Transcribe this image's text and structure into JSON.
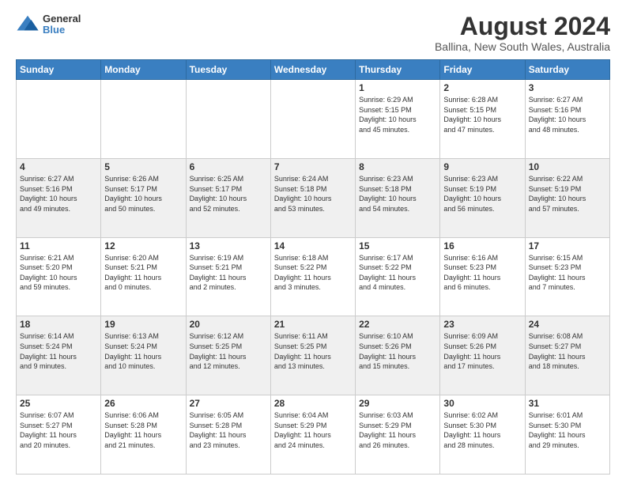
{
  "logo": {
    "general": "General",
    "blue": "Blue"
  },
  "title": "August 2024",
  "subtitle": "Ballina, New South Wales, Australia",
  "days_of_week": [
    "Sunday",
    "Monday",
    "Tuesday",
    "Wednesday",
    "Thursday",
    "Friday",
    "Saturday"
  ],
  "weeks": [
    [
      {
        "day": "",
        "info": ""
      },
      {
        "day": "",
        "info": ""
      },
      {
        "day": "",
        "info": ""
      },
      {
        "day": "",
        "info": ""
      },
      {
        "day": "1",
        "info": "Sunrise: 6:29 AM\nSunset: 5:15 PM\nDaylight: 10 hours\nand 45 minutes."
      },
      {
        "day": "2",
        "info": "Sunrise: 6:28 AM\nSunset: 5:15 PM\nDaylight: 10 hours\nand 47 minutes."
      },
      {
        "day": "3",
        "info": "Sunrise: 6:27 AM\nSunset: 5:16 PM\nDaylight: 10 hours\nand 48 minutes."
      }
    ],
    [
      {
        "day": "4",
        "info": "Sunrise: 6:27 AM\nSunset: 5:16 PM\nDaylight: 10 hours\nand 49 minutes."
      },
      {
        "day": "5",
        "info": "Sunrise: 6:26 AM\nSunset: 5:17 PM\nDaylight: 10 hours\nand 50 minutes."
      },
      {
        "day": "6",
        "info": "Sunrise: 6:25 AM\nSunset: 5:17 PM\nDaylight: 10 hours\nand 52 minutes."
      },
      {
        "day": "7",
        "info": "Sunrise: 6:24 AM\nSunset: 5:18 PM\nDaylight: 10 hours\nand 53 minutes."
      },
      {
        "day": "8",
        "info": "Sunrise: 6:23 AM\nSunset: 5:18 PM\nDaylight: 10 hours\nand 54 minutes."
      },
      {
        "day": "9",
        "info": "Sunrise: 6:23 AM\nSunset: 5:19 PM\nDaylight: 10 hours\nand 56 minutes."
      },
      {
        "day": "10",
        "info": "Sunrise: 6:22 AM\nSunset: 5:19 PM\nDaylight: 10 hours\nand 57 minutes."
      }
    ],
    [
      {
        "day": "11",
        "info": "Sunrise: 6:21 AM\nSunset: 5:20 PM\nDaylight: 10 hours\nand 59 minutes."
      },
      {
        "day": "12",
        "info": "Sunrise: 6:20 AM\nSunset: 5:21 PM\nDaylight: 11 hours\nand 0 minutes."
      },
      {
        "day": "13",
        "info": "Sunrise: 6:19 AM\nSunset: 5:21 PM\nDaylight: 11 hours\nand 2 minutes."
      },
      {
        "day": "14",
        "info": "Sunrise: 6:18 AM\nSunset: 5:22 PM\nDaylight: 11 hours\nand 3 minutes."
      },
      {
        "day": "15",
        "info": "Sunrise: 6:17 AM\nSunset: 5:22 PM\nDaylight: 11 hours\nand 4 minutes."
      },
      {
        "day": "16",
        "info": "Sunrise: 6:16 AM\nSunset: 5:23 PM\nDaylight: 11 hours\nand 6 minutes."
      },
      {
        "day": "17",
        "info": "Sunrise: 6:15 AM\nSunset: 5:23 PM\nDaylight: 11 hours\nand 7 minutes."
      }
    ],
    [
      {
        "day": "18",
        "info": "Sunrise: 6:14 AM\nSunset: 5:24 PM\nDaylight: 11 hours\nand 9 minutes."
      },
      {
        "day": "19",
        "info": "Sunrise: 6:13 AM\nSunset: 5:24 PM\nDaylight: 11 hours\nand 10 minutes."
      },
      {
        "day": "20",
        "info": "Sunrise: 6:12 AM\nSunset: 5:25 PM\nDaylight: 11 hours\nand 12 minutes."
      },
      {
        "day": "21",
        "info": "Sunrise: 6:11 AM\nSunset: 5:25 PM\nDaylight: 11 hours\nand 13 minutes."
      },
      {
        "day": "22",
        "info": "Sunrise: 6:10 AM\nSunset: 5:26 PM\nDaylight: 11 hours\nand 15 minutes."
      },
      {
        "day": "23",
        "info": "Sunrise: 6:09 AM\nSunset: 5:26 PM\nDaylight: 11 hours\nand 17 minutes."
      },
      {
        "day": "24",
        "info": "Sunrise: 6:08 AM\nSunset: 5:27 PM\nDaylight: 11 hours\nand 18 minutes."
      }
    ],
    [
      {
        "day": "25",
        "info": "Sunrise: 6:07 AM\nSunset: 5:27 PM\nDaylight: 11 hours\nand 20 minutes."
      },
      {
        "day": "26",
        "info": "Sunrise: 6:06 AM\nSunset: 5:28 PM\nDaylight: 11 hours\nand 21 minutes."
      },
      {
        "day": "27",
        "info": "Sunrise: 6:05 AM\nSunset: 5:28 PM\nDaylight: 11 hours\nand 23 minutes."
      },
      {
        "day": "28",
        "info": "Sunrise: 6:04 AM\nSunset: 5:29 PM\nDaylight: 11 hours\nand 24 minutes."
      },
      {
        "day": "29",
        "info": "Sunrise: 6:03 AM\nSunset: 5:29 PM\nDaylight: 11 hours\nand 26 minutes."
      },
      {
        "day": "30",
        "info": "Sunrise: 6:02 AM\nSunset: 5:30 PM\nDaylight: 11 hours\nand 28 minutes."
      },
      {
        "day": "31",
        "info": "Sunrise: 6:01 AM\nSunset: 5:30 PM\nDaylight: 11 hours\nand 29 minutes."
      }
    ]
  ]
}
